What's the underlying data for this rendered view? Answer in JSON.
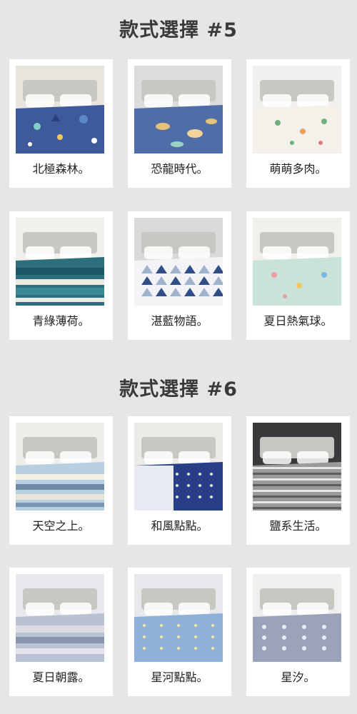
{
  "sections": [
    {
      "title": "款式選擇 #5",
      "products": [
        {
          "name": "北極森林。",
          "bedding_color": "#3f5a9a",
          "pattern": "forest-animals",
          "room_color": "#e8e4de"
        },
        {
          "name": "恐龍時代。",
          "bedding_color": "#4f6ea8",
          "pattern": "dinosaurs",
          "room_color": "#dcdcdc"
        },
        {
          "name": "萌萌多肉。",
          "bedding_color": "#f3f1ea",
          "pattern": "succulents",
          "room_color": "#f1f0ee"
        },
        {
          "name": "青綠薄荷。",
          "bedding_color": "#2d6f7c",
          "pattern": "teal-stripes",
          "room_color": "#f2f0ec"
        },
        {
          "name": "湛藍物語。",
          "bedding_color": "#f4f4f6",
          "pattern": "blue-triangles",
          "room_color": "#d9d9d9"
        },
        {
          "name": "夏日熱氣球。",
          "bedding_color": "#c9e3d9",
          "pattern": "hot-air-balloons",
          "room_color": "#f1efea"
        }
      ]
    },
    {
      "title": "款式選擇 #6",
      "products": [
        {
          "name": "天空之上。",
          "bedding_color": "#b7cfe0",
          "pattern": "sky-stripes",
          "room_color": "#f0eeea"
        },
        {
          "name": "和風點點。",
          "bedding_color": "#283e86",
          "pattern": "navy-dots",
          "room_color": "#ecebe8"
        },
        {
          "name": "鹽系生活。",
          "bedding_color": "#9a9a9a",
          "pattern": "gray-stripes",
          "room_color": "#3a3a3c"
        },
        {
          "name": "夏日朝露。",
          "bedding_color": "#b8c2d3",
          "pattern": "grey-blue-stripes",
          "room_color": "#e8e9ec"
        },
        {
          "name": "星河點點。",
          "bedding_color": "#8fb0d8",
          "pattern": "light-blue-dots",
          "room_color": "#e6e8ec"
        },
        {
          "name": "星汐。",
          "bedding_color": "#9aa3b9",
          "pattern": "star-print",
          "room_color": "#efefef"
        }
      ]
    }
  ]
}
